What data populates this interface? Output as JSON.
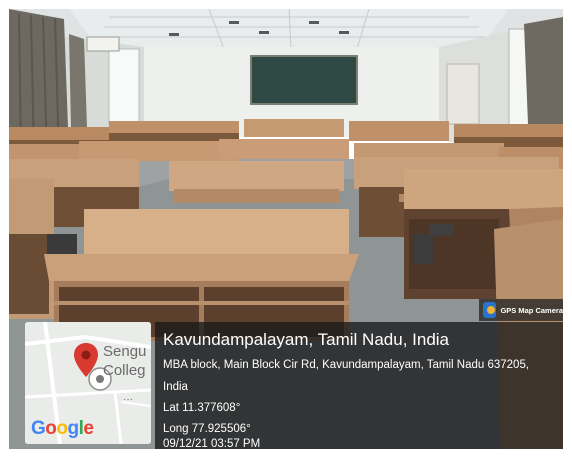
{
  "badge": {
    "label": "GPS Map Camera",
    "icon": "gps-map-camera-icon"
  },
  "map": {
    "place_line1": "Sengu",
    "place_line2": "Colleg",
    "more": "···",
    "logo": "Google",
    "pin_color": "#d93a2f"
  },
  "location": {
    "title": "Kavundampalayam, Tamil Nadu, India",
    "address_line1": "MBA block, Main Block Cir Rd, Kavundampalayam, Tamil Nadu 637205,",
    "address_line2": "India",
    "lat": "Lat 11.377608°",
    "long": "Long 77.925506°",
    "timestamp": "09/12/21 03:57 PM"
  }
}
